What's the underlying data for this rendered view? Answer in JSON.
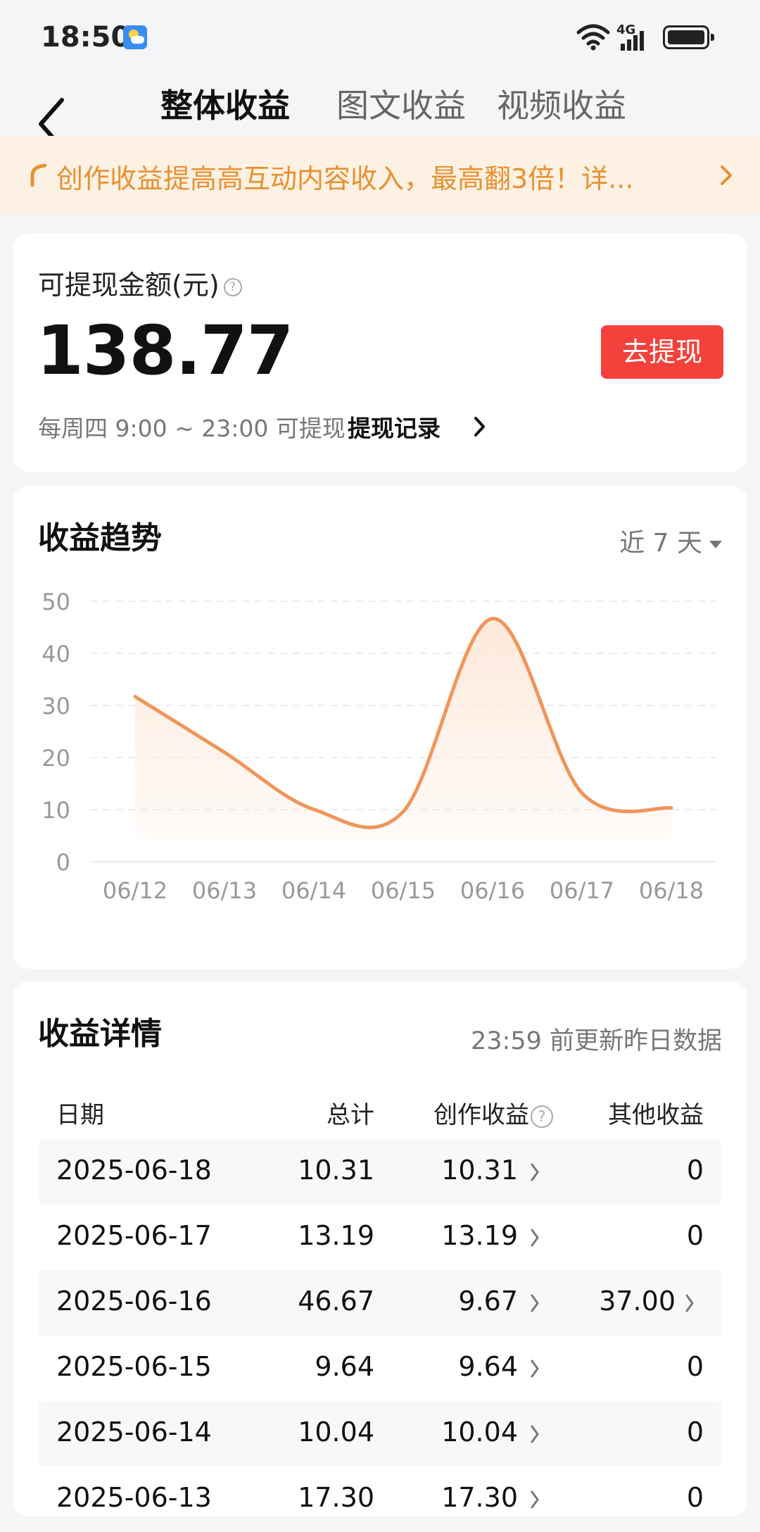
{
  "status": {
    "time": "18:50",
    "network": "4G"
  },
  "nav": {
    "tabs": [
      {
        "label": "整体收益",
        "active": true
      },
      {
        "label": "图文收益",
        "active": false
      },
      {
        "label": "视频收益",
        "active": false
      }
    ]
  },
  "banner": {
    "text": "创作收益提高高互动内容收入，最高翻3倍！详..."
  },
  "balance": {
    "label": "可提现金额(元)",
    "help": "?",
    "amount": "138.77",
    "withdraw_button": "去提现",
    "hint": "每周四 9:00 ~ 23:00 可提现",
    "record_link": "提现记录"
  },
  "trend": {
    "title": "收益趋势",
    "range": "近 7 天"
  },
  "chart_data": {
    "type": "area",
    "categories": [
      "06/12",
      "06/13",
      "06/14",
      "06/15",
      "06/16",
      "06/17",
      "06/18"
    ],
    "series": [
      {
        "values": [
          31.7,
          21.0,
          10.04,
          9.64,
          46.67,
          13.19,
          10.31
        ]
      }
    ],
    "ylim": [
      0,
      50
    ],
    "yticks": [
      0,
      10,
      20,
      30,
      40,
      50
    ],
    "grid": true,
    "line_color": "#f0955a",
    "fill_color": "#fde6d6"
  },
  "detail": {
    "title": "收益详情",
    "update_note": "23:59 前更新昨日数据",
    "columns": {
      "date": "日期",
      "total": "总计",
      "create": "创作收益",
      "create_help": "?",
      "other": "其他收益"
    },
    "rows": [
      {
        "date": "2025-06-18",
        "total": "10.31",
        "create": "10.31",
        "other": "0"
      },
      {
        "date": "2025-06-17",
        "total": "13.19",
        "create": "13.19",
        "other": "0"
      },
      {
        "date": "2025-06-16",
        "total": "46.67",
        "create": "9.67",
        "other": "37.00"
      },
      {
        "date": "2025-06-15",
        "total": "9.64",
        "create": "9.64",
        "other": "0"
      },
      {
        "date": "2025-06-14",
        "total": "10.04",
        "create": "10.04",
        "other": "0"
      },
      {
        "date": "2025-06-13",
        "total": "17.30",
        "create": "17.30",
        "other": "0"
      }
    ]
  }
}
